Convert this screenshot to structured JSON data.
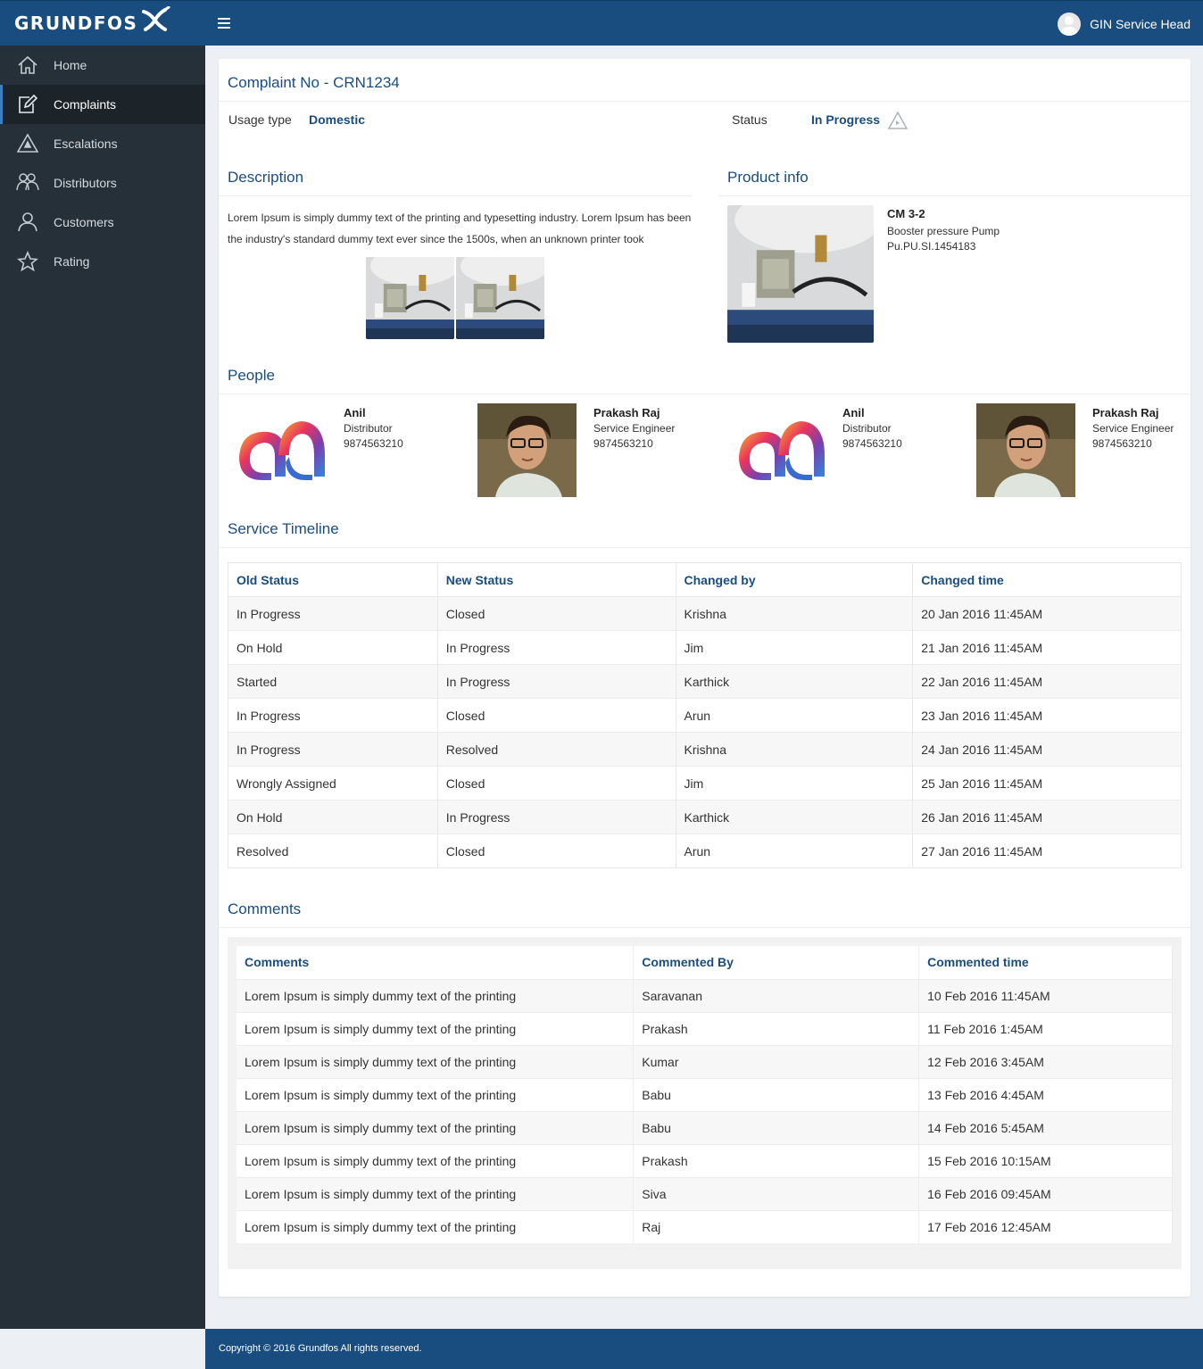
{
  "header": {
    "brand": "GRUNDFOS",
    "user_name": "GIN Service Head"
  },
  "sidebar": {
    "items": [
      {
        "label": "Home",
        "icon": "home-icon"
      },
      {
        "label": "Complaints",
        "icon": "edit-icon"
      },
      {
        "label": "Escalations",
        "icon": "warning-icon"
      },
      {
        "label": "Distributors",
        "icon": "users-icon"
      },
      {
        "label": "Customers",
        "icon": "user-icon"
      },
      {
        "label": "Rating",
        "icon": "star-icon"
      }
    ]
  },
  "complaint": {
    "title": "Complaint No - CRN1234",
    "usage_label": "Usage type",
    "usage_value": "Domestic",
    "status_label": "Status",
    "status_value": "In Progress"
  },
  "description": {
    "title": "Description",
    "text": "Lorem Ipsum is simply dummy text of the printing and typesetting industry. Lorem Ipsum has been the industry's standard dummy text ever since the 1500s, when an unknown printer took"
  },
  "product": {
    "title": "Product info",
    "name": "CM 3-2",
    "type": "Booster pressure Pump",
    "code": "Pu.PU.SI.1454183"
  },
  "people": {
    "title": "People",
    "list": [
      {
        "name": "Anil",
        "role": "Distributor",
        "phone": "9874563210"
      },
      {
        "name": "Prakash Raj",
        "role": "Service Engineer",
        "phone": "9874563210"
      },
      {
        "name": "Anil",
        "role": "Distributor",
        "phone": "9874563210"
      },
      {
        "name": "Prakash Raj",
        "role": "Service Engineer",
        "phone": "9874563210"
      }
    ]
  },
  "timeline": {
    "title": "Service Timeline",
    "headers": [
      "Old Status",
      "New Status",
      "Changed by",
      "Changed time"
    ],
    "rows": [
      [
        "In Progress",
        "Closed",
        "Krishna",
        "20 Jan 2016 11:45AM"
      ],
      [
        "On Hold",
        "In Progress",
        "Jim",
        "21 Jan 2016 11:45AM"
      ],
      [
        "Started",
        "In Progress",
        "Karthick",
        "22 Jan 2016 11:45AM"
      ],
      [
        "In Progress",
        "Closed",
        "Arun",
        "23 Jan 2016 11:45AM"
      ],
      [
        "In Progress",
        "Resolved",
        "Krishna",
        "24 Jan 2016 11:45AM"
      ],
      [
        "Wrongly Assigned",
        "Closed",
        "Jim",
        "25 Jan 2016 11:45AM"
      ],
      [
        "On Hold",
        "In Progress",
        "Karthick",
        "26 Jan 2016 11:45AM"
      ],
      [
        "Resolved",
        "Closed",
        "Arun",
        "27 Jan 2016 11:45AM"
      ]
    ]
  },
  "comments": {
    "title": "Comments",
    "headers": [
      "Comments",
      "Commented By",
      "Commented time"
    ],
    "rows": [
      [
        "Lorem Ipsum is simply dummy text of the printing",
        "Saravanan",
        "10 Feb 2016 11:45AM"
      ],
      [
        "Lorem Ipsum is simply dummy text of the printing",
        "Prakash",
        "11 Feb 2016 1:45AM"
      ],
      [
        "Lorem Ipsum is simply dummy text of the printing",
        "Kumar",
        "12 Feb 2016 3:45AM"
      ],
      [
        "Lorem Ipsum is simply dummy text of the printing",
        "Babu",
        "13 Feb 2016 4:45AM"
      ],
      [
        "Lorem Ipsum is simply dummy text of the printing",
        "Babu",
        "14 Feb 2016 5:45AM"
      ],
      [
        "Lorem Ipsum is simply dummy text of the printing",
        "Prakash",
        "15 Feb 2016 10:15AM"
      ],
      [
        "Lorem Ipsum is simply dummy text of the printing",
        "Siva",
        "16 Feb 2016 09:45AM"
      ],
      [
        "Lorem Ipsum is simply dummy text of the printing",
        "Raj",
        "17 Feb 2016 12:45AM"
      ]
    ]
  },
  "footer": {
    "text": "Copyright © 2016 Grundfos All rights reserved."
  },
  "colors": {
    "brand": "#1a4d7f",
    "sidebar": "#253038",
    "accent": "#3c7ec0"
  }
}
